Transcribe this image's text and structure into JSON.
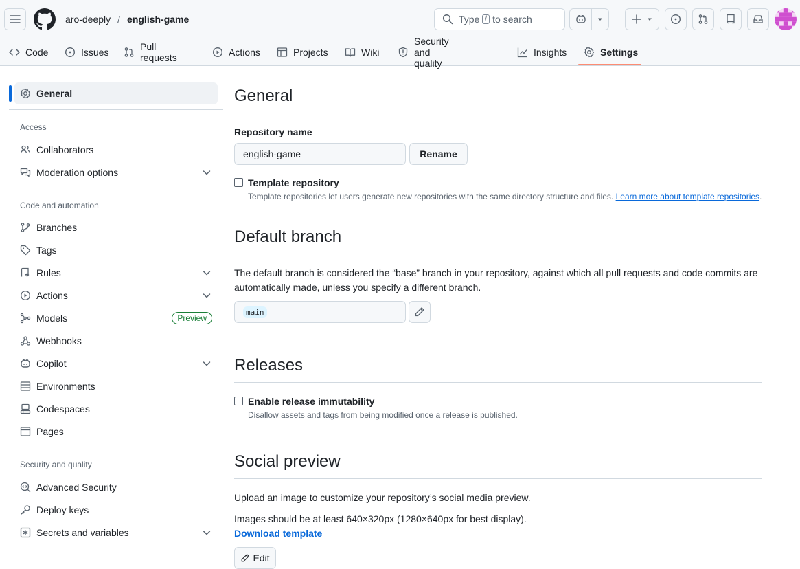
{
  "header": {
    "owner": "aro-deeply",
    "separator": "/",
    "repo": "english-game",
    "search": {
      "prefix": "Type",
      "key": "/",
      "suffix": "to search"
    }
  },
  "tabs": [
    {
      "label": "Code",
      "icon": "code-icon"
    },
    {
      "label": "Issues",
      "icon": "issue-icon"
    },
    {
      "label": "Pull requests",
      "icon": "pull-request-icon"
    },
    {
      "label": "Actions",
      "icon": "play-icon"
    },
    {
      "label": "Projects",
      "icon": "table-icon"
    },
    {
      "label": "Wiki",
      "icon": "book-icon"
    },
    {
      "label": "Security and quality",
      "icon": "shield-icon"
    },
    {
      "label": "Insights",
      "icon": "graph-icon"
    },
    {
      "label": "Settings",
      "icon": "gear-icon",
      "active": true
    }
  ],
  "sidebar": {
    "general": "General",
    "access_heading": "Access",
    "collaborators": "Collaborators",
    "moderation": "Moderation options",
    "code_heading": "Code and automation",
    "branches": "Branches",
    "tags": "Tags",
    "rules": "Rules",
    "actions": "Actions",
    "models": "Models",
    "models_badge": "Preview",
    "webhooks": "Webhooks",
    "copilot": "Copilot",
    "environments": "Environments",
    "codespaces": "Codespaces",
    "pages": "Pages",
    "security_heading": "Security and quality",
    "advanced_security": "Advanced Security",
    "deploy_keys": "Deploy keys",
    "secrets": "Secrets and variables"
  },
  "main": {
    "general_title": "General",
    "repo_name_label": "Repository name",
    "repo_name_value": "english-game",
    "rename_button": "Rename",
    "template_label": "Template repository",
    "template_desc": "Template repositories let users generate new repositories with the same directory structure and files.",
    "template_link": "Learn more about template repositories",
    "template_period": ".",
    "default_branch_title": "Default branch",
    "default_branch_desc": "The default branch is considered the “base” branch in your repository, against which all pull requests and code commits are automatically made, unless you specify a different branch.",
    "default_branch_value": "main",
    "releases_title": "Releases",
    "immutability_label": "Enable release immutability",
    "immutability_desc": "Disallow assets and tags from being modified once a release is published.",
    "social_title": "Social preview",
    "social_desc": "Upload an image to customize your repository’s social media preview.",
    "social_size": "Images should be at least 640×320px (1280×640px for best display).",
    "download_template": "Download template",
    "edit_button": "Edit"
  },
  "colors": {
    "accent": "#0969da",
    "tab_underline": "#fd8c73",
    "badge_green": "#1a7f37",
    "avatar": "#cf4fcf"
  }
}
